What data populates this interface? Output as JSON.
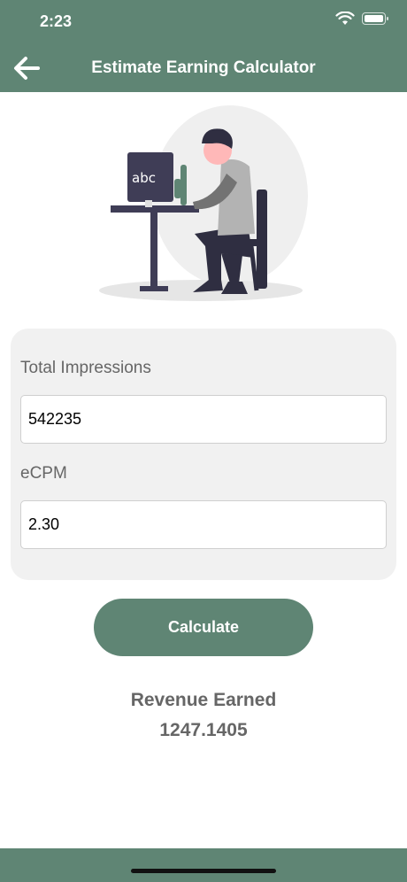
{
  "status_bar": {
    "time": "2:23"
  },
  "header": {
    "title": "Estimate Earning Calculator"
  },
  "illustration": {
    "screen_text": "abc"
  },
  "form": {
    "impressions_label": "Total Impressions",
    "impressions_value": "542235",
    "ecpm_label": "eCPM",
    "ecpm_value": "2.30"
  },
  "actions": {
    "calculate_label": "Calculate"
  },
  "result": {
    "label": "Revenue Earned",
    "value": "1247.1405"
  },
  "colors": {
    "accent": "#5f8574",
    "card_bg": "#f1f1f1",
    "text_muted": "#666666"
  }
}
